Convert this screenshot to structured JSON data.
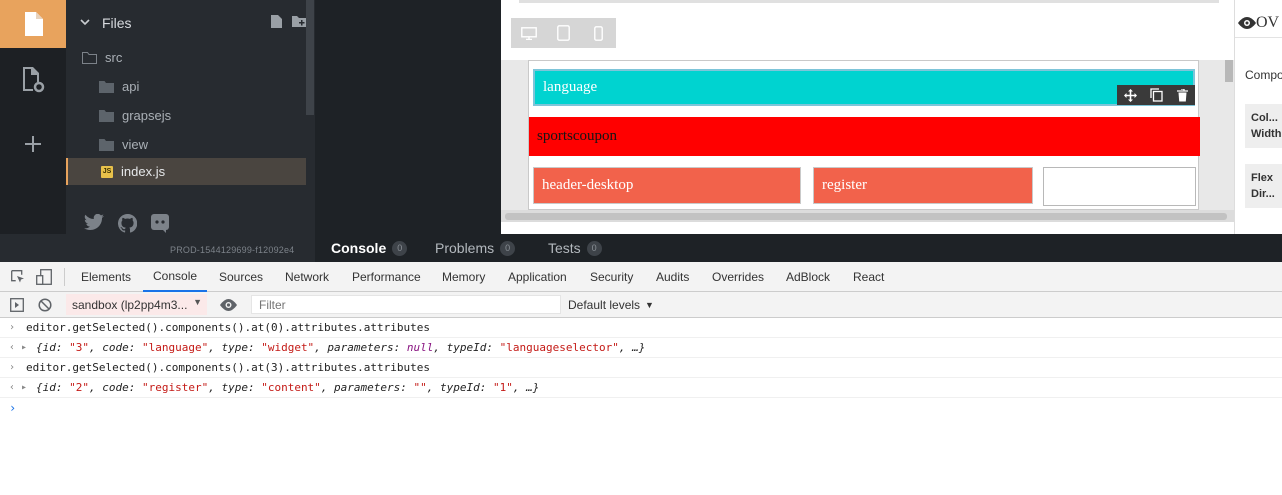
{
  "sidebar": {
    "title": "Files",
    "tree": [
      {
        "label": "src"
      },
      {
        "label": "api"
      },
      {
        "label": "grapsejs"
      },
      {
        "label": "view"
      },
      {
        "label": "index.js"
      }
    ],
    "build": "PROD-1544129699-f12092e4"
  },
  "preview": {
    "blocks": {
      "language": "language",
      "sportscoupon": "sportscoupon",
      "header": "header-desktop",
      "register": "register"
    }
  },
  "rpanel": {
    "top": "OV",
    "comp": "Compo",
    "box1_line1": "Col...",
    "box1_line2": "Width",
    "box2_line1": "Flex",
    "box2_line2": "Dir..."
  },
  "bottom_tabs": [
    {
      "label": "Console",
      "count": "0"
    },
    {
      "label": "Problems",
      "count": "0"
    },
    {
      "label": "Tests",
      "count": "0"
    }
  ],
  "devtools": {
    "tabs": [
      "Elements",
      "Console",
      "Sources",
      "Network",
      "Performance",
      "Memory",
      "Application",
      "Security",
      "Audits",
      "Overrides",
      "AdBlock",
      "React"
    ],
    "context": "sandbox (lp2pp4m3...",
    "filter_placeholder": "Filter",
    "levels": "Default levels",
    "console": {
      "cmd1": "editor.getSelected().components().at(0).attributes.attributes",
      "res1": {
        "id": "\"3\"",
        "code": "\"language\"",
        "type": "\"widget\"",
        "parameters": "null",
        "typeId": "\"languageselector\""
      },
      "cmd2": "editor.getSelected().components().at(3).attributes.attributes",
      "res2": {
        "id": "\"2\"",
        "code": "\"register\"",
        "type": "\"content\"",
        "parameters": "\"\"",
        "typeId": "\"1\""
      }
    }
  }
}
